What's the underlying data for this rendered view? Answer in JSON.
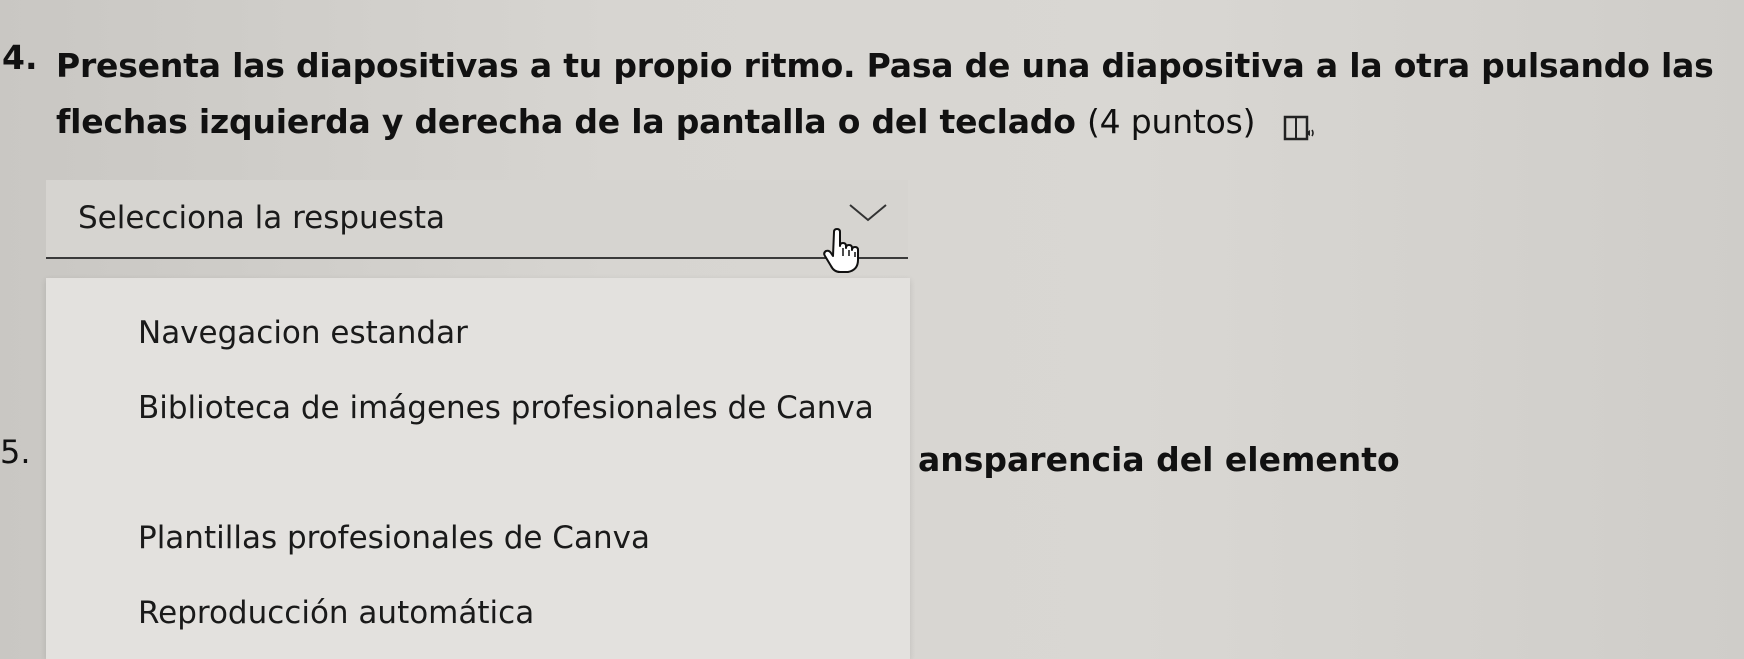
{
  "question4": {
    "number": "4.",
    "text": "Presenta las diapositivas a tu propio ritmo. Pasa de una diapositiva a la otra pulsando las flechas izquierda y derecha de la pantalla o del teclado",
    "points": "(4 puntos)"
  },
  "dropdown": {
    "selected": "Selecciona la respuesta",
    "options": [
      "Navegacion estandar",
      "Biblioteca de imágenes profesionales de Canva",
      "Plantillas profesionales de Canva",
      "Reproducción automática"
    ]
  },
  "question5": {
    "number": "5.",
    "visible_text": "ansparencia del elemento"
  },
  "icons": {
    "reader": "immersive-reader-icon",
    "chevron": "chevron-down-icon",
    "cursor": "hand-pointer-icon"
  }
}
